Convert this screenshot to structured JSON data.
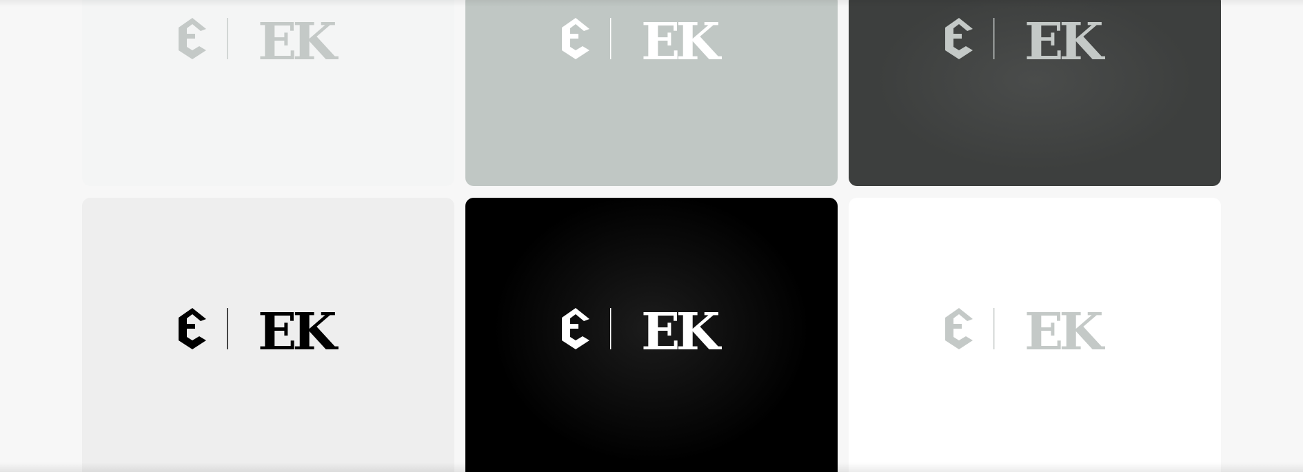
{
  "logo": {
    "monogram": "EK"
  },
  "tiles": [
    {
      "name": "tile-light-mist",
      "background": "#f4f5f5",
      "logo_color": "#c4c9c7",
      "accent_color": "#c4c9c7"
    },
    {
      "name": "tile-sage-grey",
      "background": "#c0c7c4",
      "logo_color": "#ffffff",
      "accent_color": "#ffffff"
    },
    {
      "name": "tile-charcoal",
      "background": "#3d3f3e",
      "logo_color": "#c4c9c7",
      "accent_color": "#c4c9c7"
    },
    {
      "name": "tile-light-grey",
      "background": "#eeeeee",
      "logo_color": "#000000",
      "accent_color": "#000000"
    },
    {
      "name": "tile-black",
      "background": "#000000",
      "logo_color": "#ffffff",
      "accent_color": "#ffffff"
    },
    {
      "name": "tile-white",
      "background": "#ffffff",
      "logo_color": "#c4c9c7",
      "accent_color": "#c4c9c7"
    }
  ]
}
